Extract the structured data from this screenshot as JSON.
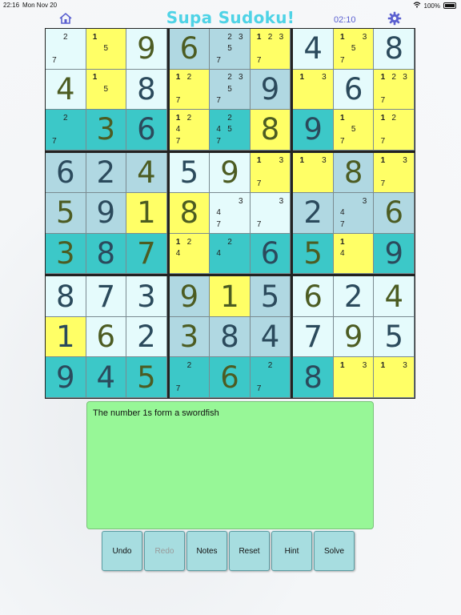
{
  "status_bar": {
    "time": "22:16",
    "date": "Mon Nov 20",
    "battery": "100%"
  },
  "header": {
    "title": "Supa Sudoku!",
    "timer": "02:10",
    "home_icon": "home-icon",
    "settings_icon": "gear-icon"
  },
  "colors": {
    "title": "#4fd3e6",
    "timer": "#5a5fd0",
    "message_bg": "#97f797",
    "button_bg": "#a7dde0"
  },
  "grid": [
    [
      {
        "n": [
          2,
          7
        ],
        "bg": "#e5fbfc"
      },
      {
        "n": [
          1,
          5
        ],
        "bg": "#ffff66",
        "hl": [
          1
        ]
      },
      {
        "v": "9",
        "c": "#4c5c22",
        "bg": "#e5fbfc"
      },
      {
        "v": "6",
        "c": "#4c5c22",
        "bg": "#b0d8e2"
      },
      {
        "n": [
          2,
          3,
          5,
          7
        ],
        "bg": "#b0d8e2"
      },
      {
        "n": [
          1,
          2,
          3,
          7
        ],
        "bg": "#ffff66",
        "hl": [
          1
        ]
      },
      {
        "v": "4",
        "c": "#2b4a5c",
        "bg": "#e5fbfc"
      },
      {
        "n": [
          1,
          3,
          5,
          7
        ],
        "bg": "#ffff66",
        "hl": [
          1
        ]
      },
      {
        "v": "8",
        "c": "#2b4a5c",
        "bg": "#e5fbfc"
      }
    ],
    [
      {
        "v": "4",
        "c": "#4c5c22",
        "bg": "#e5fbfc"
      },
      {
        "n": [
          1,
          5
        ],
        "bg": "#ffff66",
        "hl": [
          1
        ]
      },
      {
        "v": "8",
        "c": "#2b4a5c",
        "bg": "#e5fbfc"
      },
      {
        "n": [
          1,
          2,
          7
        ],
        "bg": "#ffff66",
        "hl": [
          1
        ]
      },
      {
        "n": [
          2,
          3,
          5,
          7
        ],
        "bg": "#b0d8e2"
      },
      {
        "v": "9",
        "c": "#2b4a5c",
        "bg": "#b0d8e2"
      },
      {
        "n": [
          1,
          3
        ],
        "bg": "#ffff66",
        "hl": [
          1
        ]
      },
      {
        "v": "6",
        "c": "#2b4a5c",
        "bg": "#e5fbfc"
      },
      {
        "n": [
          1,
          2,
          3,
          7
        ],
        "bg": "#ffff66",
        "hl": [
          1
        ]
      }
    ],
    [
      {
        "n": [
          2,
          7
        ],
        "bg": "#3cc8c8"
      },
      {
        "v": "3",
        "c": "#4c5c22",
        "bg": "#3cc8c8"
      },
      {
        "v": "6",
        "c": "#2b4a5c",
        "bg": "#3cc8c8"
      },
      {
        "n": [
          1,
          2,
          4,
          7
        ],
        "bg": "#ffff66",
        "hl": [
          1
        ]
      },
      {
        "n": [
          2,
          4,
          5,
          7
        ],
        "bg": "#3cc8c8"
      },
      {
        "v": "8",
        "c": "#4c5c22",
        "bg": "#ffff66"
      },
      {
        "v": "9",
        "c": "#2b4a5c",
        "bg": "#3cc8c8"
      },
      {
        "n": [
          1,
          5,
          7
        ],
        "bg": "#ffff66",
        "hl": [
          1
        ]
      },
      {
        "n": [
          1,
          2,
          7
        ],
        "bg": "#ffff66",
        "hl": [
          1
        ]
      }
    ],
    [
      {
        "v": "6",
        "c": "#2b4a5c",
        "bg": "#b0d8e2"
      },
      {
        "v": "2",
        "c": "#2b4a5c",
        "bg": "#b0d8e2"
      },
      {
        "v": "4",
        "c": "#4c5c22",
        "bg": "#b0d8e2"
      },
      {
        "v": "5",
        "c": "#2b4a5c",
        "bg": "#e5fbfc"
      },
      {
        "v": "9",
        "c": "#4c5c22",
        "bg": "#e5fbfc"
      },
      {
        "n": [
          1,
          3,
          7
        ],
        "bg": "#ffff66",
        "hl": [
          1
        ]
      },
      {
        "n": [
          1,
          3
        ],
        "bg": "#ffff66",
        "hl": [
          1
        ]
      },
      {
        "v": "8",
        "c": "#4c5c22",
        "bg": "#b0d8e2"
      },
      {
        "n": [
          1,
          3,
          7
        ],
        "bg": "#ffff66",
        "hl": [
          1
        ]
      }
    ],
    [
      {
        "v": "5",
        "c": "#4c5c22",
        "bg": "#b0d8e2"
      },
      {
        "v": "9",
        "c": "#2b4a5c",
        "bg": "#b0d8e2"
      },
      {
        "v": "1",
        "c": "#4c5c22",
        "bg": "#ffff66"
      },
      {
        "v": "8",
        "c": "#4c5c22",
        "bg": "#ffff66"
      },
      {
        "n": [
          3,
          4,
          7
        ],
        "bg": "#e5fbfc"
      },
      {
        "n": [
          3,
          7
        ],
        "bg": "#e5fbfc"
      },
      {
        "v": "2",
        "c": "#2b4a5c",
        "bg": "#b0d8e2"
      },
      {
        "n": [
          3,
          4,
          7
        ],
        "bg": "#b0d8e2"
      },
      {
        "v": "6",
        "c": "#4c5c22",
        "bg": "#b0d8e2"
      }
    ],
    [
      {
        "v": "3",
        "c": "#4c5c22",
        "bg": "#3cc8c8"
      },
      {
        "v": "8",
        "c": "#2b4a5c",
        "bg": "#3cc8c8"
      },
      {
        "v": "7",
        "c": "#4c5c22",
        "bg": "#3cc8c8"
      },
      {
        "n": [
          1,
          2,
          4
        ],
        "bg": "#ffff66",
        "hl": [
          1
        ]
      },
      {
        "n": [
          2,
          4
        ],
        "bg": "#3cc8c8"
      },
      {
        "v": "6",
        "c": "#2b4a5c",
        "bg": "#3cc8c8"
      },
      {
        "v": "5",
        "c": "#4c5c22",
        "bg": "#3cc8c8"
      },
      {
        "n": [
          1,
          4
        ],
        "bg": "#ffff66",
        "hl": [
          1
        ]
      },
      {
        "v": "9",
        "c": "#2b4a5c",
        "bg": "#3cc8c8"
      }
    ],
    [
      {
        "v": "8",
        "c": "#2b4a5c",
        "bg": "#e5fbfc"
      },
      {
        "v": "7",
        "c": "#2b4a5c",
        "bg": "#e5fbfc"
      },
      {
        "v": "3",
        "c": "#2b4a5c",
        "bg": "#e5fbfc"
      },
      {
        "v": "9",
        "c": "#4c5c22",
        "bg": "#b0d8e2"
      },
      {
        "v": "1",
        "c": "#4c5c22",
        "bg": "#ffff66"
      },
      {
        "v": "5",
        "c": "#2b4a5c",
        "bg": "#b0d8e2"
      },
      {
        "v": "6",
        "c": "#4c5c22",
        "bg": "#e5fbfc"
      },
      {
        "v": "2",
        "c": "#2b4a5c",
        "bg": "#e5fbfc"
      },
      {
        "v": "4",
        "c": "#4c5c22",
        "bg": "#e5fbfc"
      }
    ],
    [
      {
        "v": "1",
        "c": "#2b4a5c",
        "bg": "#ffff66"
      },
      {
        "v": "6",
        "c": "#4c5c22",
        "bg": "#e5fbfc"
      },
      {
        "v": "2",
        "c": "#2b4a5c",
        "bg": "#e5fbfc"
      },
      {
        "v": "3",
        "c": "#4c5c22",
        "bg": "#b0d8e2"
      },
      {
        "v": "8",
        "c": "#2b4a5c",
        "bg": "#b0d8e2"
      },
      {
        "v": "4",
        "c": "#2b4a5c",
        "bg": "#b0d8e2"
      },
      {
        "v": "7",
        "c": "#2b4a5c",
        "bg": "#e5fbfc"
      },
      {
        "v": "9",
        "c": "#4c5c22",
        "bg": "#e5fbfc"
      },
      {
        "v": "5",
        "c": "#2b4a5c",
        "bg": "#e5fbfc"
      }
    ],
    [
      {
        "v": "9",
        "c": "#2b4a5c",
        "bg": "#3cc8c8"
      },
      {
        "v": "4",
        "c": "#2b4a5c",
        "bg": "#3cc8c8"
      },
      {
        "v": "5",
        "c": "#4c5c22",
        "bg": "#3cc8c8"
      },
      {
        "n": [
          2,
          7
        ],
        "bg": "#3cc8c8"
      },
      {
        "v": "6",
        "c": "#4c5c22",
        "bg": "#3cc8c8"
      },
      {
        "n": [
          2,
          7
        ],
        "bg": "#3cc8c8"
      },
      {
        "v": "8",
        "c": "#2b4a5c",
        "bg": "#3cc8c8"
      },
      {
        "n": [
          1,
          3
        ],
        "bg": "#ffff66",
        "hl": [
          1
        ]
      },
      {
        "n": [
          1,
          3
        ],
        "bg": "#ffff66",
        "hl": [
          1
        ]
      }
    ]
  ],
  "message": {
    "text": "The number 1s form a swordfish"
  },
  "buttons": [
    {
      "label": "Undo",
      "enabled": true
    },
    {
      "label": "Redo",
      "enabled": false
    },
    {
      "label": "Notes",
      "enabled": true
    },
    {
      "label": "Reset",
      "enabled": true
    },
    {
      "label": "Hint",
      "enabled": true
    },
    {
      "label": "Solve",
      "enabled": true
    }
  ]
}
